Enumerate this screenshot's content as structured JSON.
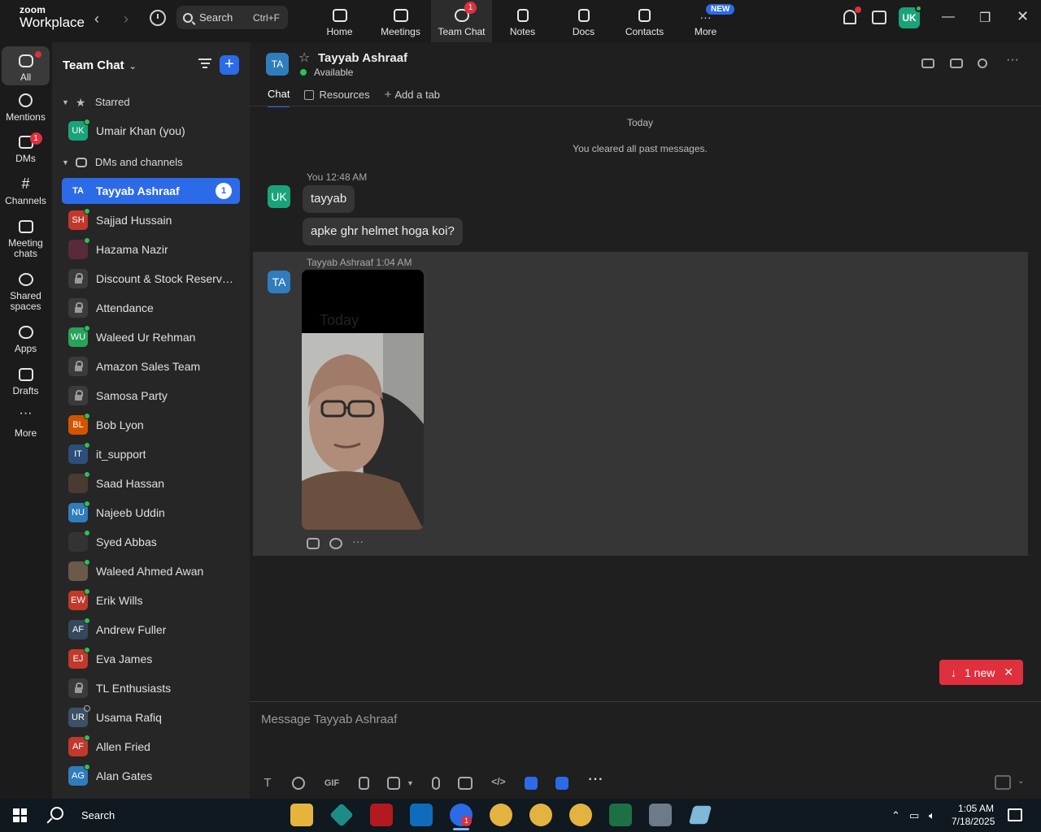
{
  "app": {
    "brand_top": "zoom",
    "brand_bottom": "Workplace"
  },
  "search": {
    "label": "Search",
    "shortcut": "Ctrl+F"
  },
  "top_tabs": [
    {
      "label": "Home",
      "icon": "home-icon"
    },
    {
      "label": "Meetings",
      "icon": "video-camera-icon"
    },
    {
      "label": "Team Chat",
      "icon": "chat-bubble-icon",
      "badge": "1"
    },
    {
      "label": "Notes",
      "icon": "notes-icon"
    },
    {
      "label": "Docs",
      "icon": "document-icon"
    },
    {
      "label": "Contacts",
      "icon": "contacts-icon"
    },
    {
      "label": "More",
      "icon": "more-icon",
      "badge": "NEW"
    }
  ],
  "profile": {
    "initials": "UK"
  },
  "rail": [
    {
      "label": "All"
    },
    {
      "label": "Mentions"
    },
    {
      "label": "DMs",
      "badge": "1"
    },
    {
      "label": "Channels"
    },
    {
      "label": "Meeting chats"
    },
    {
      "label": "Shared spaces"
    },
    {
      "label": "Apps"
    },
    {
      "label": "Drafts"
    },
    {
      "label": "More"
    }
  ],
  "sidebar": {
    "title": "Team Chat",
    "starred_label": "Starred",
    "starred": [
      {
        "initials": "UK",
        "name": "Umair Khan (you)",
        "color": "#1aa37a"
      }
    ],
    "dms_label": "DMs and channels",
    "items": [
      {
        "initials": "TA",
        "name": "Tayyab Ashraaf",
        "color": "#2c6be8",
        "count": "1"
      },
      {
        "initials": "SH",
        "name": "Sajjad Hussain",
        "color": "#c0392b"
      },
      {
        "initials": "",
        "name": "Hazama Nazir",
        "color": "#5a2a3a"
      },
      {
        "initials": "",
        "name": "Discount & Stock Reservati...",
        "lock": true
      },
      {
        "initials": "",
        "name": "Attendance",
        "lock": true
      },
      {
        "initials": "WU",
        "name": "Waleed Ur Rehman",
        "color": "#27a35a"
      },
      {
        "initials": "",
        "name": "Amazon Sales Team",
        "lock": true
      },
      {
        "initials": "",
        "name": "Samosa Party",
        "lock": true
      },
      {
        "initials": "BL",
        "name": "Bob Lyon",
        "color": "#d35400"
      },
      {
        "initials": "IT",
        "name": "it_support",
        "color": "#2b4f7a"
      },
      {
        "initials": "",
        "name": "Saad Hassan",
        "color": "#4a3a33"
      },
      {
        "initials": "NU",
        "name": "Najeeb Uddin",
        "color": "#2f7dbd"
      },
      {
        "initials": "",
        "name": "Syed Abbas",
        "color": "#333"
      },
      {
        "initials": "",
        "name": "Waleed Ahmed Awan",
        "color": "#6b5a4a"
      },
      {
        "initials": "EW",
        "name": "Erik Wills",
        "color": "#c0392b"
      },
      {
        "initials": "AF",
        "name": "Andrew Fuller",
        "color": "#34495e"
      },
      {
        "initials": "EJ",
        "name": "Eva James",
        "color": "#c0392b"
      },
      {
        "initials": "",
        "name": "TL Enthusiasts",
        "lock": true
      },
      {
        "initials": "UR",
        "name": "Usama Rafiq",
        "color": "#3d5166",
        "offline": true
      },
      {
        "initials": "AF",
        "name": "Allen Fried",
        "color": "#c0392b"
      },
      {
        "initials": "AG",
        "name": "Alan Gates",
        "color": "#2f7dbd"
      }
    ]
  },
  "chat": {
    "initials": "TA",
    "name": "Tayyab Ashraaf",
    "status": "Available",
    "tabs": {
      "chat": "Chat",
      "resources": "Resources",
      "add": "Add a tab"
    },
    "day_label": "Today",
    "cleared_notice": "You cleared all past messages.",
    "messages": [
      {
        "sender_initials": "UK",
        "meta_name": "You",
        "time": "12:48 AM",
        "bubbles": [
          "tayyab",
          "apke ghr helmet hoga koi?"
        ]
      },
      {
        "sender_initials": "TA",
        "meta_name": "Tayyab Ashraaf",
        "time": "1:04 AM",
        "image_caption": "Today"
      }
    ],
    "new_pill": "1 new",
    "composer_placeholder": "Message Tayyab Ashraaf"
  },
  "composer_tools": {
    "text": "T",
    "gif": "GIF"
  },
  "taskbar": {
    "search_label": "Search",
    "time": "1:05 AM",
    "date": "7/18/2025",
    "zoom_badge": "1"
  },
  "colors": {
    "accent": "#2c6be8",
    "alert": "#e02f3d",
    "online": "#2bc257"
  }
}
